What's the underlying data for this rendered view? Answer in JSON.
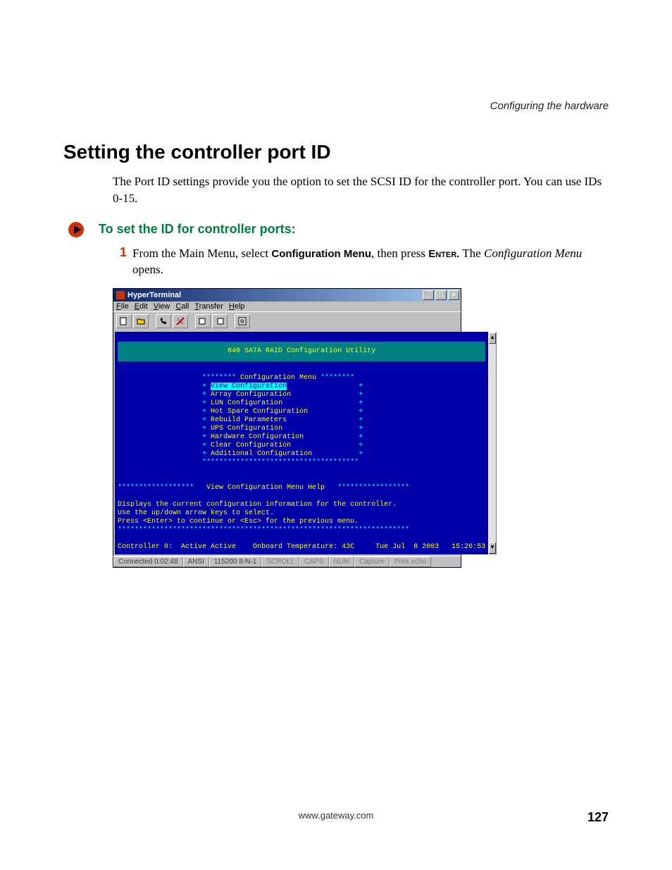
{
  "doc": {
    "running_head": "Configuring the hardware",
    "h1": "Setting the controller port ID",
    "intro": "The Port ID settings provide you the option to set the SCSI ID for the controller port. You can use IDs 0-15.",
    "proc_title": "To set the ID for controller ports:",
    "step1_num": "1",
    "step1_pre": "From the Main Menu, select ",
    "step1_bold1": "Configuration Menu",
    "step1_mid": ", then press ",
    "step1_caps": "Enter.",
    "step1_post": " The ",
    "step1_italic": "Configuration Menu",
    "step1_end": " opens.",
    "footer_url": "www.gateway.com",
    "page_number": "127"
  },
  "shot": {
    "title": "HyperTerminal",
    "win_btns": {
      "min": "_",
      "max": "□",
      "close": "×"
    },
    "menubar": [
      "File",
      "Edit",
      "View",
      "Call",
      "Transfer",
      "Help"
    ],
    "term": {
      "banner": "840 SATA RAID Configuration Utility",
      "menu_title_left": "********",
      "menu_title": " Configuration Menu ",
      "menu_title_right": "********",
      "items": [
        "View Configuration",
        "Array Configuration",
        "LUN Configuration",
        "Hot Spare Configuration",
        "Rebuild Parameters",
        "UPS Configuration",
        "Hardware Configuration",
        "Clear Configuration",
        "Additional Configuration"
      ],
      "menu_bottom": "*************************************",
      "help_title_left": "******************",
      "help_title": "   View Configuration Menu Help   ",
      "help_title_right": "*****************",
      "help_line1": "Displays the current configuration information for the controller.",
      "help_line2": "Use the up/down arrow keys to select.",
      "help_line3": "Press <Enter> to continue or <Esc> for the previous menu.",
      "help_bottom": "*********************************************************************",
      "status_controller": "Controller 0:  Active Active",
      "status_temp": "Onboard Temperature: 43C",
      "status_datetime": "Tue Jul  8 2003   15:26:53"
    },
    "statusbar": {
      "c1": "Connected 0:02:48",
      "c2": "ANSI",
      "c3": "115200 8-N-1",
      "c4": "SCROLL",
      "c5": "CAPS",
      "c6": "NUM",
      "c7": "Capture",
      "c8": "Print echo"
    }
  }
}
